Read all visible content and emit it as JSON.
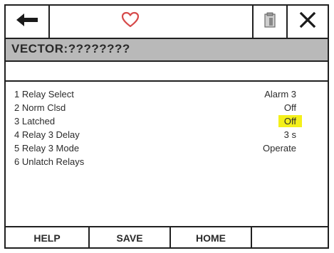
{
  "toolbar": {
    "back_icon": "left-arrow-icon",
    "favorite_icon": "heart-outline-icon",
    "clipboard_icon": "clipboard-icon",
    "close_icon": "close-icon",
    "heart_color": "#d64a4a"
  },
  "header": {
    "title": "VECTOR:????????"
  },
  "menu": {
    "items": [
      {
        "label": "1 Relay Select",
        "value": "Alarm 3"
      },
      {
        "label": "2 Norm Clsd",
        "value": "Off"
      },
      {
        "label": "3 Latched",
        "value": "Off",
        "highlight": true
      },
      {
        "label": "4 Relay 3 Delay",
        "value": "3 s"
      },
      {
        "label": "5 Relay 3 Mode",
        "value": "Operate"
      },
      {
        "label": "6 Unlatch Relays",
        "value": ""
      }
    ],
    "highlight_color": "#f4f01a"
  },
  "softkeys": {
    "help": "HELP",
    "save": "SAVE",
    "home": "HOME",
    "blank": ""
  }
}
